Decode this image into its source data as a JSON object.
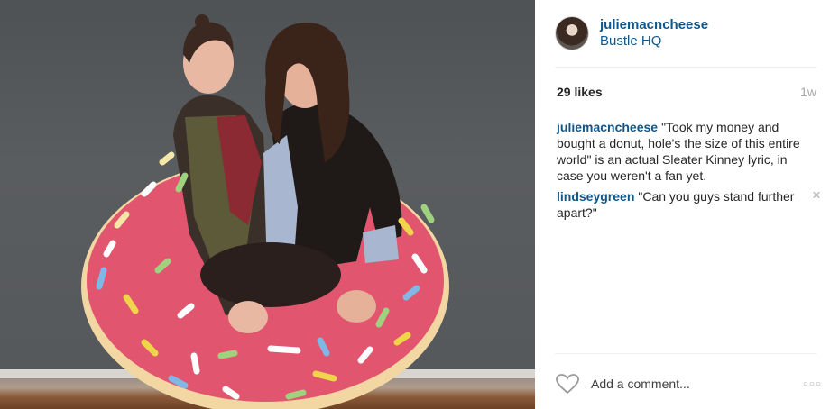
{
  "post": {
    "username": "juliemacncheese",
    "location": "Bustle HQ",
    "likes": "29 likes",
    "age": "1w"
  },
  "comments": [
    {
      "author": "juliemacncheese",
      "text": "\"Took my money and bought a donut, hole's the size of this entire world\" is an actual Sleater Kinney lyric, in case you weren't a fan yet."
    },
    {
      "author": "lindseygreen",
      "text": "\"Can you guys stand further apart?\""
    }
  ],
  "comment_bar": {
    "placeholder": "Add a comment...",
    "heart_icon": "heart-icon",
    "more_icon": "more-options-icon"
  },
  "colors": {
    "link": "#125688",
    "text": "#262626",
    "muted": "#a5a7aa",
    "donut_frosting": "#e0506f",
    "donut_dough": "#f1d6a0"
  }
}
